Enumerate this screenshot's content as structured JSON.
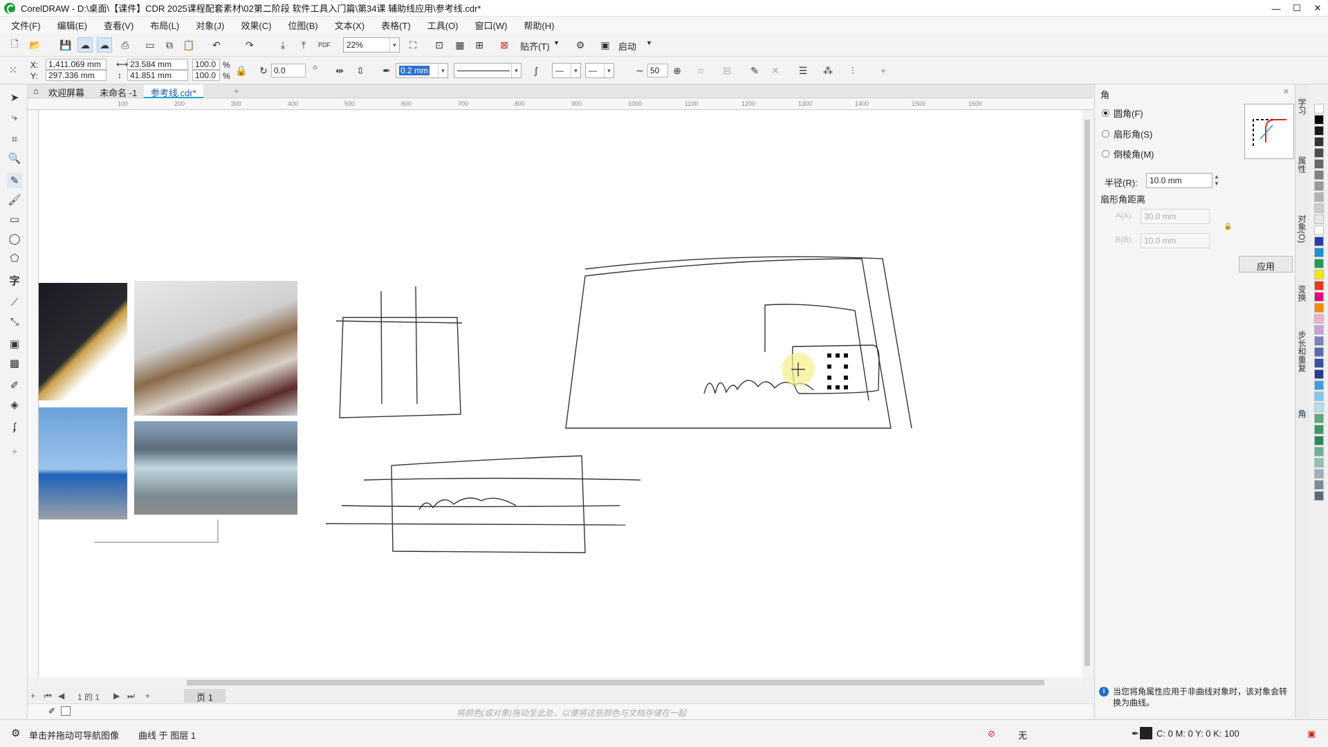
{
  "window": {
    "title": "CorelDRAW - D:\\桌面\\【课件】CDR 2025课程配套素材\\02第二阶段 软件工具入门篇\\第34课 辅助线应用\\参考线.cdr*",
    "controls": [
      "—",
      "☐",
      "✕"
    ]
  },
  "menu": [
    "文件(F)",
    "编辑(E)",
    "查看(V)",
    "布局(L)",
    "对象(J)",
    "效果(C)",
    "位图(B)",
    "文本(X)",
    "表格(T)",
    "工具(O)",
    "窗口(W)",
    "帮助(H)"
  ],
  "toolbar": {
    "zoom": "22%",
    "snap_label": "贴齐(T)",
    "launch_label": "启动"
  },
  "propbar": {
    "x_label": "X:",
    "y_label": "Y:",
    "x_value": "1,411.069 mm",
    "y_value": "297.336 mm",
    "w_value": "23.584 mm",
    "h_value": "41.851 mm",
    "scale_w": "100.0",
    "scale_h": "100.0",
    "pct": "%",
    "angle": "0.0",
    "outline_width": "0.2 mm",
    "smoothing": "50"
  },
  "doc_tabs": [
    {
      "label": "欢迎屏幕"
    },
    {
      "label": "未命名 -1"
    },
    {
      "label": "参考线.cdr*"
    }
  ],
  "ruler_ticks": [
    "100",
    "200",
    "300",
    "400",
    "500",
    "600",
    "700",
    "800",
    "900",
    "1000",
    "1100",
    "1200",
    "1300",
    "1400",
    "1500",
    "1600"
  ],
  "pagenav": {
    "page_of": "1 的 1",
    "page_tab": "页 1"
  },
  "colorbar_hint": "将颜色(或对象)拖动至此处，以便将这些颜色与文档存储在一起",
  "status": {
    "left": "单击并拖动可导航图像",
    "layer": "曲线 于 图层 1",
    "fill": "无",
    "outline": "C: 0 M: 0 Y: 0 K: 100"
  },
  "docker": {
    "title": "角",
    "options": [
      {
        "label": "圆角(F)",
        "selected": true
      },
      {
        "label": "扇形角(S)",
        "selected": false
      },
      {
        "label": "倒棱角(M)",
        "selected": false
      }
    ],
    "radius_label": "半径(R):",
    "radius_value": "10.0 mm",
    "scallop_label": "扇形角距离",
    "dist1_label": "A(A):",
    "dist1_value": "30.0 mm",
    "dist2_label": "B(B):",
    "dist2_value": "10.0 mm",
    "apply_label": "应用",
    "info": "当您将角属性应用于非曲线对象时，该对象会转换为曲线。"
  },
  "side_tabs": [
    "学习",
    "属性",
    "对象(O)",
    "变换",
    "步长和重复",
    "角"
  ],
  "palette_colors": [
    "#ffffff",
    "#000000",
    "#1a1a1a",
    "#333333",
    "#4d4d4d",
    "#666666",
    "#808080",
    "#999999",
    "#b3b3b3",
    "#cccccc",
    "#e6e6e6",
    "#ffffff",
    "#2a3aa8",
    "#1e90d6",
    "#20a050",
    "#f5e600",
    "#e83a1e",
    "#e6007e",
    "#f08c00",
    "#f6b0c8",
    "#c8a0e0",
    "#8080c0",
    "#5a6ab8",
    "#3a50a0",
    "#2a3a90",
    "#3aa0e0",
    "#80c8f0",
    "#b0e0f0",
    "#5aaa7a",
    "#3a9a6a",
    "#2a8a5a",
    "#6ab0a0",
    "#90c0b0",
    "#a0b0b8",
    "#7a8a98",
    "#5a6a7a"
  ]
}
